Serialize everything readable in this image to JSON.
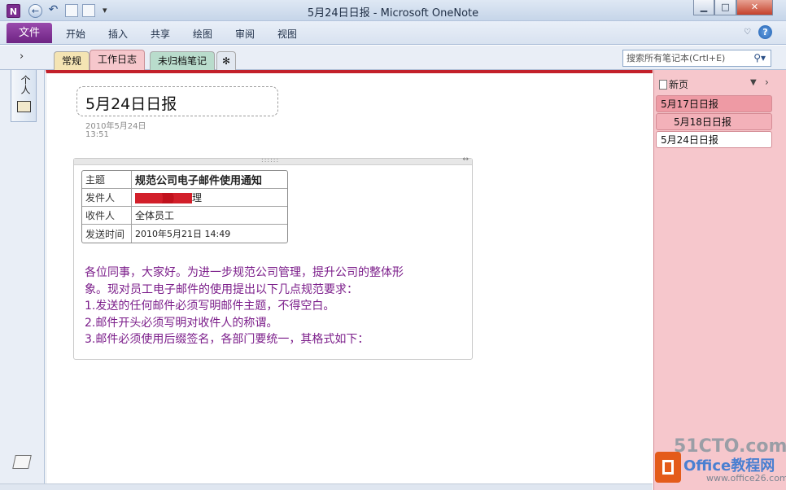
{
  "window": {
    "title": "5月24日日报 - Microsoft OneNote",
    "app_icon": "N",
    "minimize": "▁",
    "maximize": "□",
    "close": "✕"
  },
  "quick_access": {
    "back_icon": "←",
    "undo_icon": "↶",
    "dropdown_icon": "▾"
  },
  "ribbon": {
    "file": "文件",
    "tabs": [
      "开始",
      "插入",
      "共享",
      "绘图",
      "审阅",
      "视图"
    ],
    "help": "?",
    "minimize_ribbon": "♡"
  },
  "sections": {
    "expand_icon": "›",
    "tabs": [
      {
        "label": "常规",
        "color": "#f4e4b3"
      },
      {
        "label": "工作日志",
        "color": "#f6c7cc"
      },
      {
        "label": "未归档笔记",
        "color": "#b9dccc"
      },
      {
        "label": "✻",
        "color": "#e2e8f0"
      }
    ],
    "search_placeholder": "搜索所有笔记本(Crtl+E)",
    "search_icon": "⚲▾"
  },
  "notebook": {
    "label": "个人"
  },
  "page": {
    "title": "5月24日日报",
    "date": "2010年5月24日",
    "time": "13:51",
    "outline_grip": "::::::",
    "outline_resize": "↔",
    "table": [
      {
        "key": "主题",
        "value": "规范公司电子邮件使用通知"
      },
      {
        "key": "发件人",
        "value": "理"
      },
      {
        "key": "收件人",
        "value": "全体员工"
      },
      {
        "key": "发送时间",
        "value": "2010年5月21日 14:49"
      }
    ],
    "body": [
      "各位同事，大家好。为进一步规范公司管理，提升公司的整体形",
      "象。现对员工电子邮件的使用提出以下几点规范要求：",
      "1.发送的任何邮件必须写明邮件主题，不得空白。",
      "2.邮件开头必须写明对收件人的称谓。",
      "3.邮件必须使用后缀签名，各部门要统一，其格式如下："
    ]
  },
  "pages_pane": {
    "new_page": "新页",
    "dropdown": "▼",
    "collapse": "›",
    "pages": [
      "5月17日日报",
      "5月18日日报",
      "5月24日日报"
    ]
  },
  "watermark": {
    "line1": "51CTO.com",
    "line2": "Office教程网",
    "line3": "www.office26.com"
  }
}
